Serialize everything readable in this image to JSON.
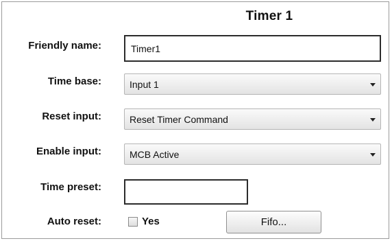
{
  "header": {
    "title": "Timer 1"
  },
  "fields": {
    "friendly_name": {
      "label": "Friendly name:",
      "value": "Timer1"
    },
    "time_base": {
      "label": "Time base:",
      "value": "Input 1"
    },
    "reset_input": {
      "label": "Reset input:",
      "value": "Reset Timer Command"
    },
    "enable_input": {
      "label": "Enable input:",
      "value": "MCB Active"
    },
    "time_preset": {
      "label": "Time preset:",
      "value": ""
    },
    "auto_reset": {
      "label": "Auto reset:",
      "checkbox_label": "Yes",
      "checked": false
    }
  },
  "buttons": {
    "fifo": "Fifo..."
  }
}
